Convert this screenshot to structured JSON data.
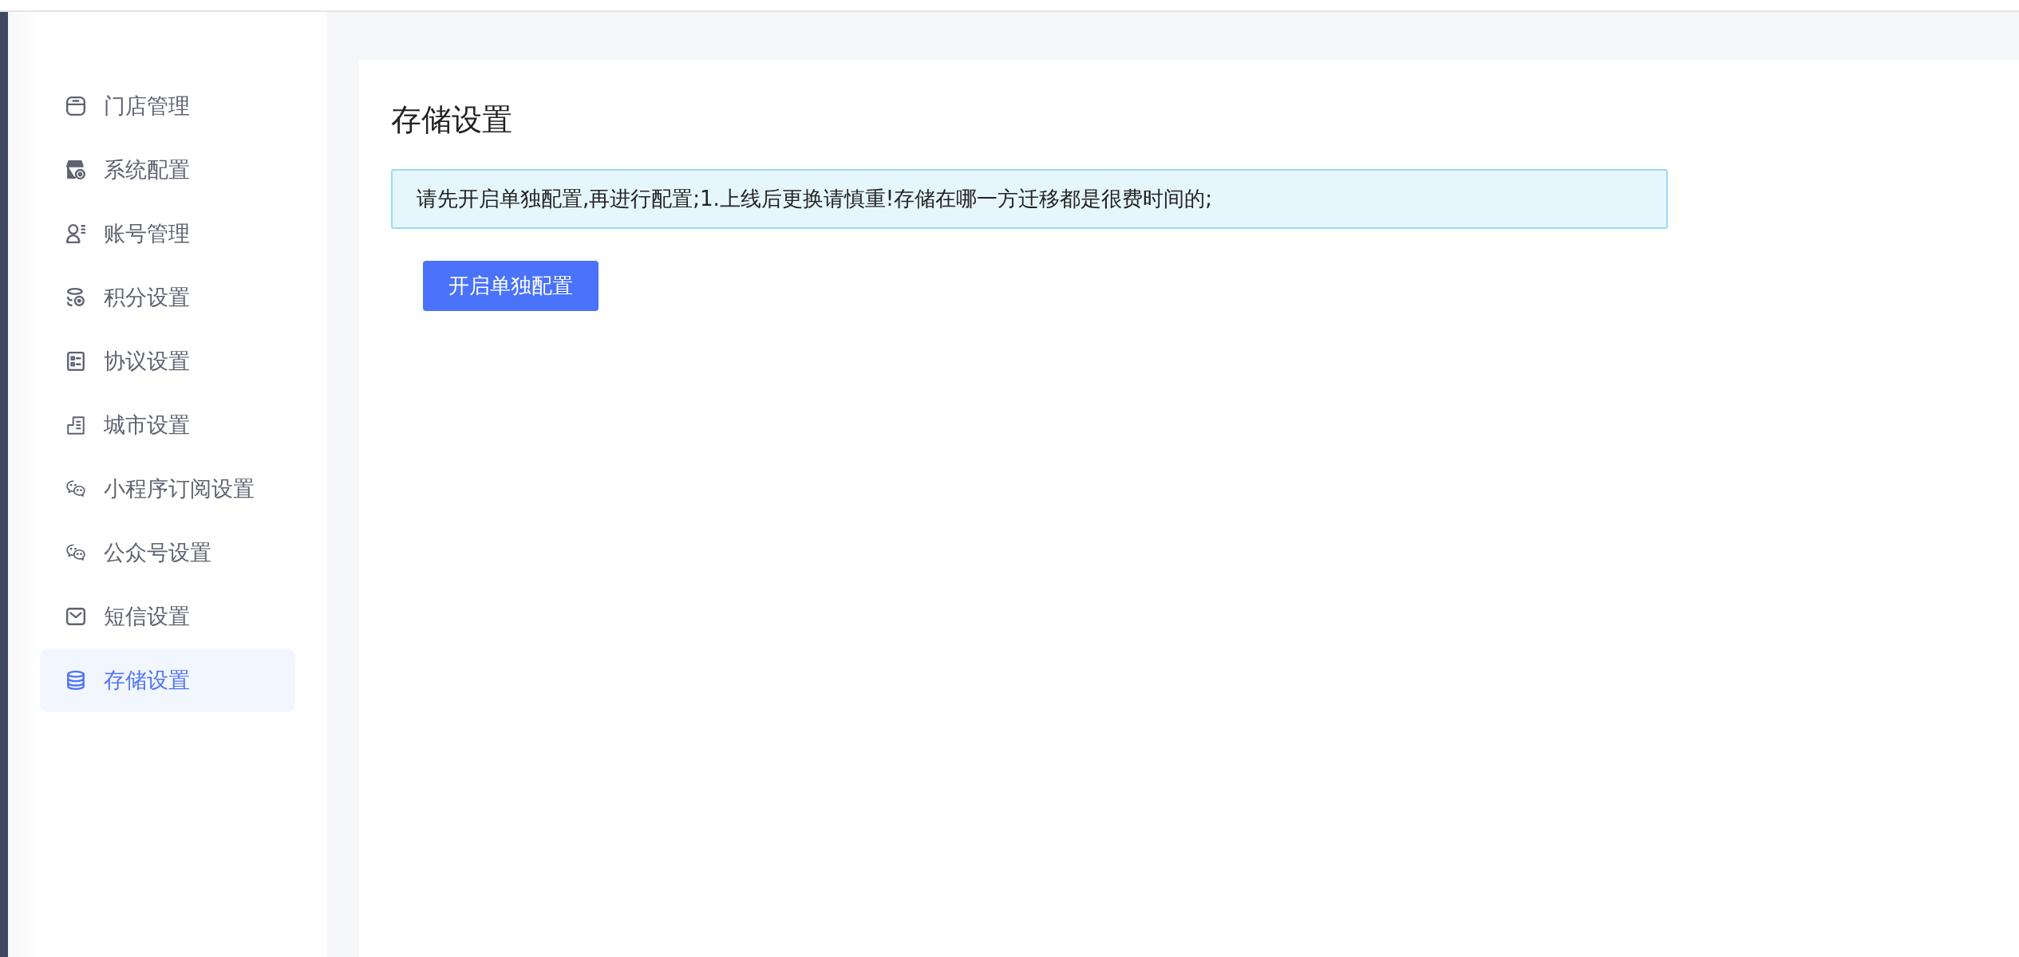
{
  "sidebar": {
    "items": [
      {
        "label": "门店管理",
        "selected": false
      },
      {
        "label": "系统配置",
        "selected": false
      },
      {
        "label": "账号管理",
        "selected": false
      },
      {
        "label": "积分设置",
        "selected": false
      },
      {
        "label": "协议设置",
        "selected": false
      },
      {
        "label": "城市设置",
        "selected": false
      },
      {
        "label": "小程序订阅设置",
        "selected": false
      },
      {
        "label": "公众号设置",
        "selected": false
      },
      {
        "label": "短信设置",
        "selected": false
      },
      {
        "label": "存储设置",
        "selected": true
      }
    ]
  },
  "page": {
    "title": "存储设置",
    "notice": "请先开启单独配置,再进行配置;1.上线后更换请慎重!存储在哪一方迁移都是很费时间的;",
    "button": "开启单独配置"
  }
}
